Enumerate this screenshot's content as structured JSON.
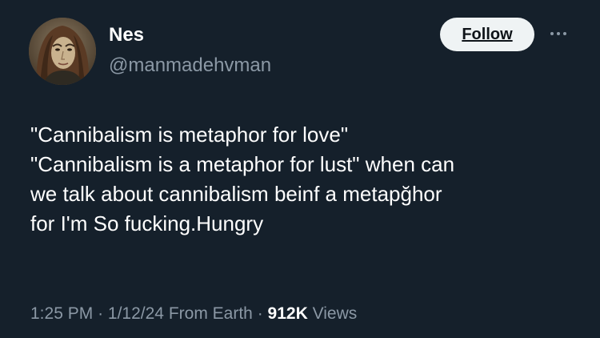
{
  "author": {
    "display_name": "Nes",
    "handle": "@manmadehvman"
  },
  "header": {
    "follow_label": "Follow",
    "more_icon": "more-horizontal-icon"
  },
  "tweet": {
    "lines": [
      "\"Cannibalism is metaphor for love\"",
      "\"Cannibalism is a metaphor for lust\" when can",
      "we talk about cannibalism beinf a metapğhor",
      "for I'm So fucking.Hungry"
    ]
  },
  "meta": {
    "time": "1:25 PM",
    "separator": "·",
    "date": "1/12/24",
    "source": "From Earth",
    "views_count": "912K",
    "views_label": "Views"
  },
  "colors": {
    "background": "#15202b",
    "text_primary": "#ffffff",
    "text_secondary": "#8b98a5",
    "button_bg": "#eff3f4"
  }
}
